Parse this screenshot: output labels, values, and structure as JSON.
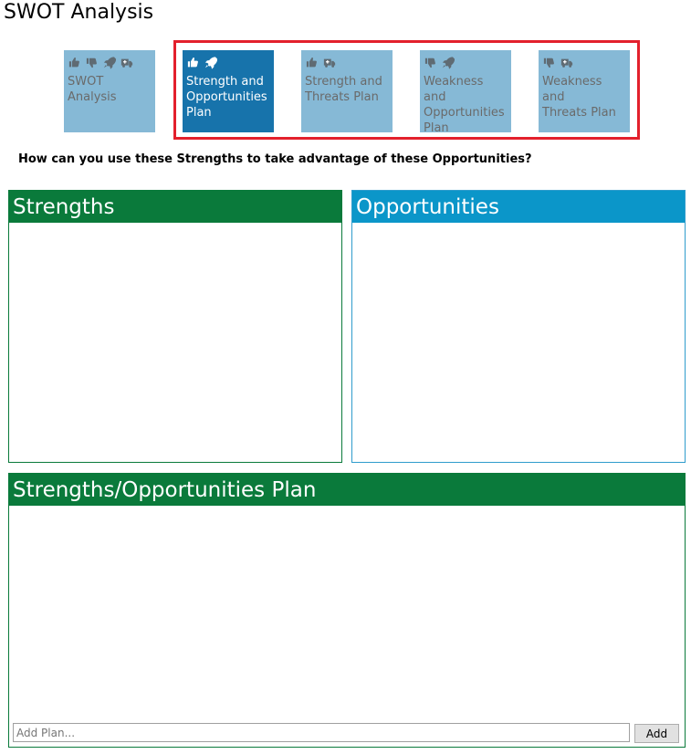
{
  "page": {
    "title": "SWOT Analysis"
  },
  "tabs": [
    {
      "label": "SWOT\nAnalysis",
      "icons": [
        "thumbs-up-icon",
        "thumbs-down-icon",
        "rocket-icon",
        "ambulance-icon"
      ],
      "active": false
    },
    {
      "label": "Strength and\nOpportunities\nPlan",
      "icons": [
        "thumbs-up-icon",
        "rocket-icon"
      ],
      "active": true
    },
    {
      "label": "Strength and\nThreats Plan",
      "icons": [
        "thumbs-up-icon",
        "ambulance-icon"
      ],
      "active": false
    },
    {
      "label": "Weakness and\nOpportunities\nPlan",
      "icons": [
        "thumbs-down-icon",
        "rocket-icon"
      ],
      "active": false
    },
    {
      "label": "Weakness and\nThreats Plan",
      "icons": [
        "thumbs-down-icon",
        "ambulance-icon"
      ],
      "active": false
    }
  ],
  "question": "How can you use these Strengths to take advantage of these Opportunities?",
  "panels": {
    "strengths": {
      "title": "Strengths"
    },
    "opportunities": {
      "title": "Opportunities"
    },
    "plan": {
      "title": "Strengths/Opportunities Plan"
    }
  },
  "add_plan": {
    "placeholder": "Add Plan...",
    "value": "",
    "button_label": "Add"
  },
  "colors": {
    "tile_inactive": "#86b9d6",
    "tile_active": "#1773ab",
    "green": "#0a7a3b",
    "blue": "#0b96c9",
    "highlight": "#e3202c"
  }
}
